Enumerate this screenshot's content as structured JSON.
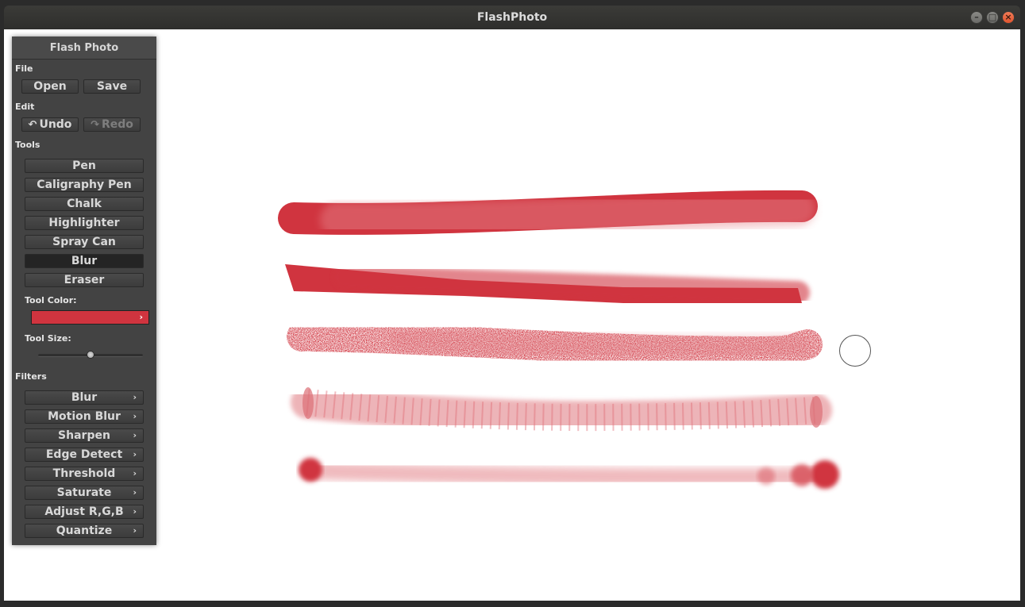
{
  "window": {
    "title": "FlashPhoto",
    "minimize_glyph": "–",
    "maximize_glyph": "□",
    "close_glyph": "×"
  },
  "panel": {
    "title": "Flash Photo",
    "file": {
      "label": "File",
      "open_label": "Open",
      "save_label": "Save"
    },
    "edit": {
      "label": "Edit",
      "undo_label": "Undo",
      "redo_label": "Redo",
      "undo_icon": "undo-arrow-icon",
      "redo_icon": "redo-arrow-icon",
      "redo_enabled": false
    },
    "tools": {
      "label": "Tools",
      "items": [
        "Pen",
        "Caligraphy Pen",
        "Chalk",
        "Highlighter",
        "Spray Can",
        "Blur",
        "Eraser"
      ],
      "selected": "Blur",
      "tool_color_label": "Tool Color:",
      "tool_color": "#d0343f",
      "tool_size_label": "Tool Size:",
      "tool_size_fraction": 0.5
    },
    "filters": {
      "label": "Filters",
      "items": [
        "Blur",
        "Motion Blur",
        "Sharpen",
        "Edge Detect",
        "Threshold",
        "Saturate",
        "Adjust R,G,B",
        "Quantize"
      ]
    }
  },
  "colors": {
    "stroke": "#d0343f",
    "panel_bg": "#434343",
    "canvas_bg": "#ffffff",
    "titlebar_bg": "#2e2e2c",
    "close_button": "#e0552f"
  }
}
